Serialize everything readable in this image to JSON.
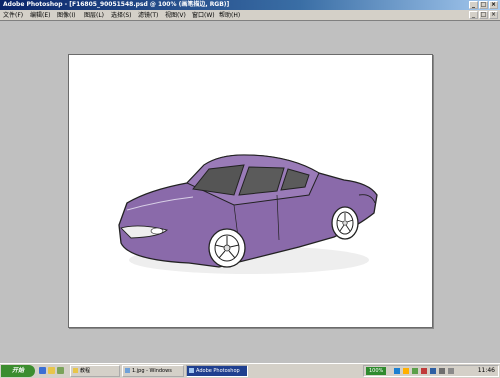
{
  "window": {
    "title": "Adobe Photoshop - [F16805_90051548.psd @ 100% (画笔描边, RGB)]",
    "controls": [
      "_",
      "□",
      "×"
    ]
  },
  "menu": {
    "items": [
      "文件(F)",
      "编辑(E)",
      "图像(I)",
      "图层(L)",
      "选择(S)",
      "滤镜(T)",
      "视图(V)",
      "窗口(W)",
      "帮助(H)"
    ],
    "doc_controls": [
      "_",
      "□",
      "×"
    ]
  },
  "canvas": {
    "background": "#ffffff",
    "car": {
      "body_color": "#8a6aaa",
      "window_color": "#555555",
      "outline_color": "#222222"
    }
  },
  "taskbar": {
    "start_label": "开始",
    "buttons": [
      {
        "label": "教程",
        "icon": "folder-icon"
      },
      {
        "label": "1.jpg - Windows",
        "icon": "image-viewer-icon"
      },
      {
        "label": "Adobe Photoshop",
        "icon": "photoshop-icon",
        "active": true
      }
    ],
    "tray": {
      "zoom": "100%",
      "clock": "11:46"
    }
  },
  "colors": {
    "titlebar": "#0a246a",
    "workspace": "#c0c0c0",
    "taskbar": "#d4d0c8",
    "start": "#3c8d2f"
  }
}
